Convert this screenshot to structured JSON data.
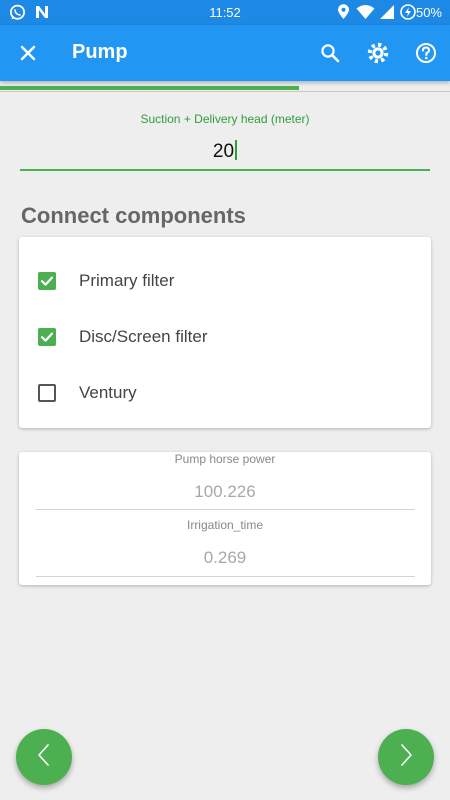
{
  "status_bar": {
    "time": "11:52",
    "battery_percent": "50%",
    "left_icons": [
      "whatsapp-icon",
      "n-app-icon"
    ],
    "right_icons": [
      "location-icon",
      "wifi-icon",
      "signal-icon",
      "battery-charging-icon"
    ]
  },
  "app_bar": {
    "title": "Pump",
    "actions": [
      "close-icon",
      "search-icon",
      "settings-icon",
      "help-icon"
    ]
  },
  "progress": {
    "fraction": 0.665
  },
  "head_field": {
    "label": "Suction + Delivery head (meter)",
    "value": "20"
  },
  "connect": {
    "title": "Connect components",
    "items": [
      {
        "label": "Primary filter",
        "checked": true
      },
      {
        "label": "Disc/Screen filter",
        "checked": true
      },
      {
        "label": "Ventury",
        "checked": false
      }
    ]
  },
  "results": {
    "horse_power_label": "Pump horse power",
    "horse_power_value": "100.226",
    "irrigation_label": "Irrigation_time",
    "irrigation_value": "0.269"
  },
  "nav": {
    "prev_icon": "chevron-left-icon",
    "next_icon": "chevron-right-icon"
  },
  "colors": {
    "status_bar": "#1e88e5",
    "app_bar": "#2196f3",
    "accent_green": "#4caf50",
    "background": "#eeeeee"
  }
}
